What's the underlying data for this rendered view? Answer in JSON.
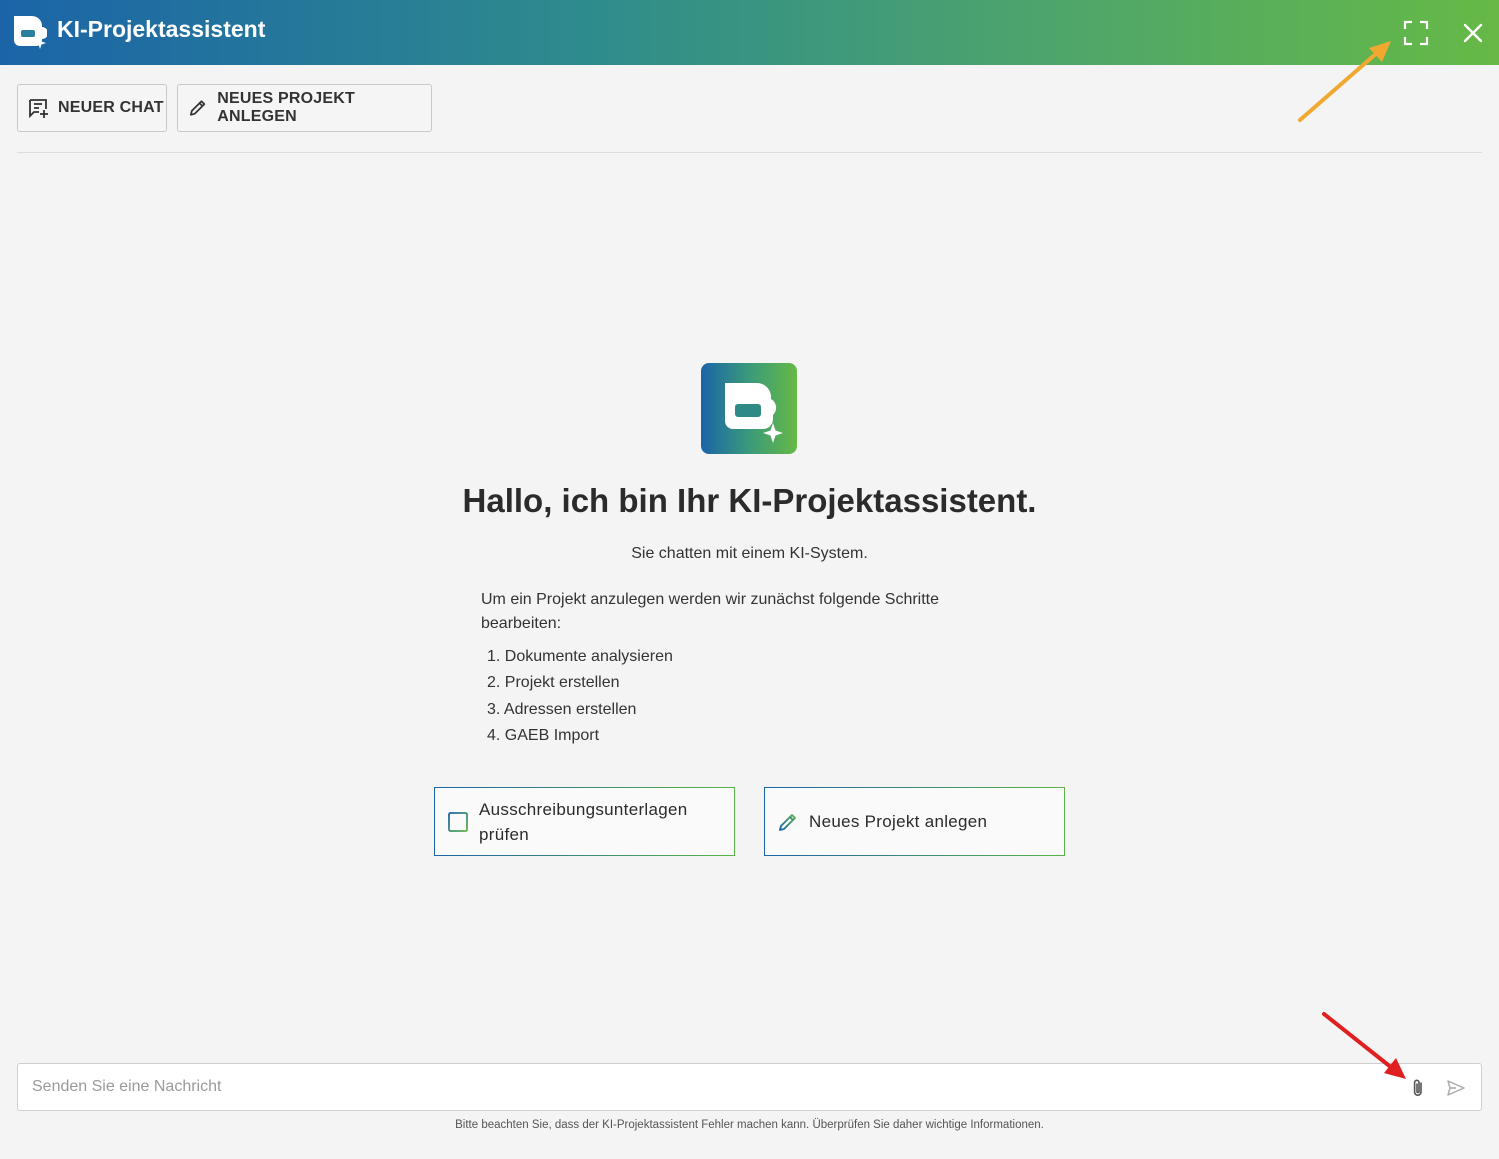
{
  "window": {
    "title": "KI-Projektassistent",
    "fullscreen_icon": "fullscreen-icon",
    "close_icon": "close-icon"
  },
  "toolbar": {
    "new_chat_label": "NEUER CHAT",
    "new_project_label": "NEUES PROJEKT ANLEGEN"
  },
  "welcome": {
    "heading": "Hallo, ich bin Ihr KI-Projektassistent.",
    "subheading": "Sie chatten mit einem KI-System.",
    "intro": "Um ein Projekt anzulegen werden wir zunächst folgende Schritte bearbeiten:",
    "steps": [
      "1. Dokumente analysieren",
      "2. Projekt erstellen",
      "3. Adressen erstellen",
      "4. GAEB Import"
    ]
  },
  "actions": [
    {
      "label": "Ausschreibungsunterlagen prüfen",
      "icon": "checklist-icon"
    },
    {
      "label": "Neues Projekt anlegen",
      "icon": "pencil-icon"
    }
  ],
  "chat": {
    "placeholder": "Senden Sie eine Nachricht",
    "value": "",
    "attach_icon": "paperclip-icon",
    "send_icon": "send-icon"
  },
  "disclaimer": "Bitte beachten Sie, dass der KI-Projektassistent Fehler machen kann. Überprüfen Sie daher wichtige Informationen.",
  "colors": {
    "header_gradient_start": "#1b64a8",
    "header_gradient_end": "#66b946",
    "annotation_arrow_orange": "#f0a830",
    "annotation_arrow_red": "#e02020"
  }
}
